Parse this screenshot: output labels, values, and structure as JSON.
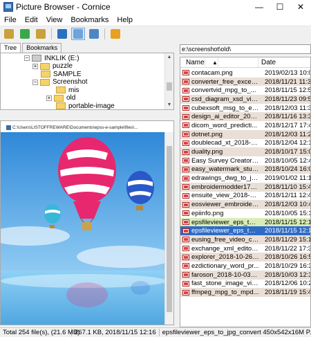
{
  "window": {
    "title": "Picture Browser - Cornice",
    "minimize": "—",
    "maximize": "☐",
    "close": "✕"
  },
  "menu": [
    "File",
    "Edit",
    "View",
    "Bookmarks",
    "Help"
  ],
  "toolbar": [
    {
      "name": "back-icon",
      "color": "#c9a13b"
    },
    {
      "name": "up-icon",
      "color": "#3aa84a"
    },
    {
      "name": "folder-up-icon",
      "color": "#c9a13b"
    },
    {
      "name": "refresh-icon",
      "color": "#2d6fbf"
    },
    {
      "name": "list-view-icon",
      "color": "#6fa3dc",
      "active": true
    },
    {
      "name": "thumbnail-view-icon",
      "color": "#4d86c6"
    },
    {
      "name": "stop-icon",
      "color": "#e8a020"
    }
  ],
  "left_tabs": [
    "Tree",
    "Bookmarks"
  ],
  "tree": [
    {
      "label": "INKLIK (E:)",
      "type": "drive",
      "exp": "−"
    },
    {
      "label": "puzzle",
      "type": "folder",
      "exp": "+"
    },
    {
      "label": "SAMPLE",
      "type": "folder",
      "exp": ""
    },
    {
      "label": "Screenshot",
      "type": "folder",
      "exp": "−"
    },
    {
      "label": "mis",
      "type": "folder",
      "exp": ""
    },
    {
      "label": "old",
      "type": "folder",
      "exp": "+"
    },
    {
      "label": "portable-image",
      "type": "folder",
      "exp": ""
    }
  ],
  "preview": {
    "path": "C:\\Users\\LISTOFFREWARE\\Documents\\epss-e-sample\\files\\..."
  },
  "path_box": "e:\\screenshot\\old\\",
  "file_list": {
    "headers": {
      "name": "Name",
      "date": "Date",
      "sort_arrow": "▲"
    },
    "rows": [
      {
        "name": "contacam.png",
        "date": "2019/02/13 10:05"
      },
      {
        "name": "converter_free_excel_t...",
        "date": "2018/11/21 11:34"
      },
      {
        "name": "convertvid_mpg_to_...",
        "date": "2018/11/15 12:50"
      },
      {
        "name": "csd_diagram_xsd_vie...",
        "date": "2018/11/23 09:55"
      },
      {
        "name": "cubexsoft_msg_to_em...",
        "date": "2018/12/03 11:34"
      },
      {
        "name": "design_ai_editor_2018...",
        "date": "2018/11/16 13:38"
      },
      {
        "name": "dicom_word_predicti...",
        "date": "2018/12/17 17:48"
      },
      {
        "name": "dotnet.png",
        "date": "2018/12/03 11:25"
      },
      {
        "name": "doublecad_xt_2018-12...",
        "date": "2018/12/04 12:11"
      },
      {
        "name": "duality.png",
        "date": "2018/10/17 15:02"
      },
      {
        "name": "Easy Survey Creator_2...",
        "date": "2018/10/05 12:40"
      },
      {
        "name": "easy_watermark_studi...",
        "date": "2018/10/24 16:05"
      },
      {
        "name": "edrawings_dwg_to_jp...",
        "date": "2019/01/02 11:16"
      },
      {
        "name": "embroidermodder170...",
        "date": "2018/11/10 15:47"
      },
      {
        "name": "ensuite_view_2018-12...",
        "date": "2018/12/11 12:45"
      },
      {
        "name": "eosviewer_embroider...",
        "date": "2018/12/03 10:47"
      },
      {
        "name": "epiinfo.png",
        "date": "2018/10/05 15:10"
      },
      {
        "name": "epsfileviewer_eps_to_j...",
        "date": "2018/11/15 12:17",
        "state": "hl"
      },
      {
        "name": "epsfileviewer_eps_to_j...",
        "date": "2018/11/15 12:16",
        "state": "sel"
      },
      {
        "name": "eusing_free_video_co...",
        "date": "2018/11/29 15:13"
      },
      {
        "name": "exchange_xml_editor_...",
        "date": "2018/11/22 17:38"
      },
      {
        "name": "explorer_2018-10-26_1...",
        "date": "2018/10/26 16:50"
      },
      {
        "name": "ezdictionary_word_pr...",
        "date": "2018/10/29 16:37"
      },
      {
        "name": "faroson_2018-10-03_1...",
        "date": "2018/10/03 12:34"
      },
      {
        "name": "fast_stone_image_vie...",
        "date": "2018/12/06 10:20"
      },
      {
        "name": "ffmpeg_mpg_to_mpd...",
        "date": "2018/11/19 15:47"
      }
    ]
  },
  "status": {
    "total": "Total 254 file(s), (21.6 MB)",
    "size": "267.1 KB, 2018/11/15 12:16",
    "file": "epsfileviewer_eps_to_jpg_convert 450x542x16M P..."
  }
}
